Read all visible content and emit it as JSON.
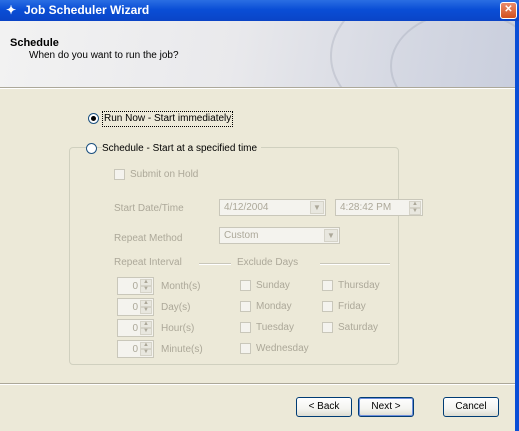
{
  "window": {
    "title": "Job Scheduler Wizard",
    "icon": "wizard-icon",
    "close_glyph": "✕",
    "colors": {
      "titlebar": "#0a4ed6",
      "face": "#ece9d8",
      "disabled_text": "#aca899"
    }
  },
  "header": {
    "title": "Schedule",
    "subtitle": "When do you want to run the job?"
  },
  "options": {
    "run_now": {
      "label": "Run Now - Start immediately",
      "selected": true
    },
    "schedule": {
      "label": "Schedule - Start at a specified time",
      "selected": false
    }
  },
  "schedule_group": {
    "submit_on_hold": {
      "label": "Submit on Hold",
      "checked": false
    },
    "start_datetime": {
      "label": "Start Date/Time",
      "date": "4/12/2004",
      "time": "4:28:42 PM"
    },
    "repeat_method": {
      "label": "Repeat Method",
      "value": "Custom"
    },
    "repeat_interval": {
      "label": "Repeat Interval",
      "units": [
        {
          "value": "0",
          "label": "Month(s)"
        },
        {
          "value": "0",
          "label": "Day(s)"
        },
        {
          "value": "0",
          "label": "Hour(s)"
        },
        {
          "value": "0",
          "label": "Minute(s)"
        }
      ]
    },
    "exclude_days": {
      "label": "Exclude Days",
      "days": [
        "Sunday",
        "Monday",
        "Tuesday",
        "Wednesday",
        "Thursday",
        "Friday",
        "Saturday"
      ]
    }
  },
  "buttons": {
    "back": "< Back",
    "next": "Next >",
    "cancel": "Cancel"
  }
}
